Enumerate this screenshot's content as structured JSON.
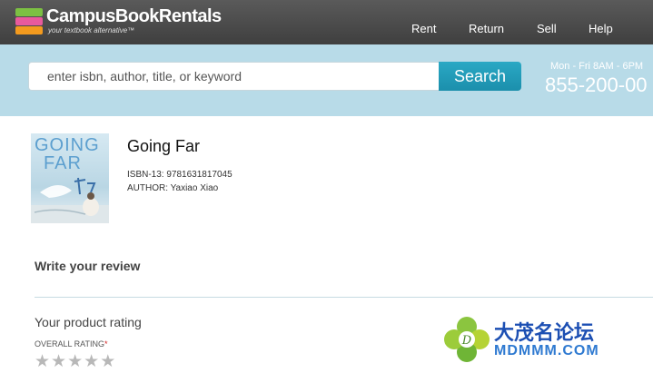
{
  "brand": {
    "name": "CampusBookRentals",
    "tagline": "your textbook alternative™"
  },
  "nav": {
    "items": [
      {
        "label": "Rent"
      },
      {
        "label": "Return"
      },
      {
        "label": "Sell"
      },
      {
        "label": "Help"
      }
    ]
  },
  "search": {
    "placeholder": "enter isbn, author, title, or keyword",
    "button_label": "Search"
  },
  "contact": {
    "hours": "Mon - Fri 8AM - 6PM",
    "phone": "855-200-00"
  },
  "book": {
    "cover_text_line1": "GOING",
    "cover_text_line2": "FAR",
    "title": "Going Far",
    "isbn": "ISBN-13: 9781631817045",
    "author": "AUTHOR: Yaxiao Xiao"
  },
  "review": {
    "heading": "Write your review",
    "rating_heading": "Your product rating",
    "overall_label": "OVERALL RATING",
    "required_mark": "*",
    "stars_max": 5
  },
  "watermark": {
    "line1": "大茂名论坛",
    "line2": "MDMMM.COM"
  },
  "colors": {
    "topbar": "#4a4a4a",
    "search_band": "#b8dbe8",
    "search_button": "#2aa8c4",
    "star_empty": "#b8b8b8"
  }
}
